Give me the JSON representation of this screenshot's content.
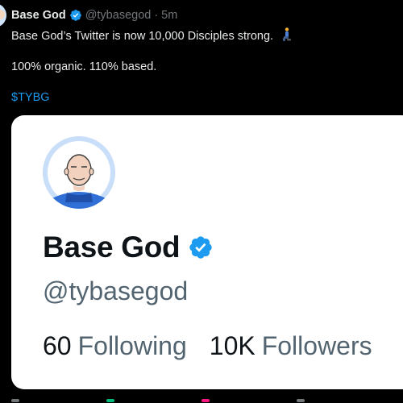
{
  "tweet": {
    "author_name": "Base God",
    "handle": "@tybasegod",
    "separator": "·",
    "time": "5m",
    "text_line1": "Base God’s Twitter is now 10,000 Disciples strong.",
    "text_line2": "100% organic. 110% based.",
    "cashtag": "$TYBG",
    "emoji_icon": "kneeling-person-icon"
  },
  "card": {
    "name": "Base God",
    "handle": "@tybasegod",
    "following_count": "60",
    "following_label": "Following",
    "followers_count": "10K",
    "followers_label": "Followers"
  },
  "colors": {
    "background": "#000000",
    "text_primary": "#e7e9ea",
    "text_secondary": "#71767b",
    "accent": "#1d9bf0",
    "card_bg": "#ffffff",
    "card_text": "#0f1419",
    "card_secondary": "#536471"
  }
}
